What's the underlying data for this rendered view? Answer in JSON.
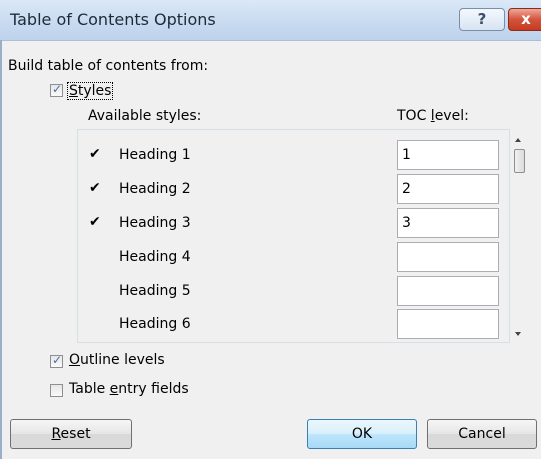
{
  "dialog": {
    "title": "Table of Contents Options",
    "help_glyph": "?",
    "close_glyph": "x"
  },
  "build_label": "Build table of contents from:",
  "styles_option": {
    "label_prefix": "",
    "label_accel": "S",
    "label_suffix": "tyles",
    "checked": true,
    "check_glyph": "✓"
  },
  "columns": {
    "available_styles": "Available styles:",
    "toc_level_prefix": "TOC ",
    "toc_level_accel": "l",
    "toc_level_suffix": "evel:"
  },
  "styles": [
    {
      "name": "Heading 1",
      "checked": true,
      "check_glyph": "✔",
      "level": "1"
    },
    {
      "name": "Heading 2",
      "checked": true,
      "check_glyph": "✔",
      "level": "2"
    },
    {
      "name": "Heading 3",
      "checked": true,
      "check_glyph": "✔",
      "level": "3"
    },
    {
      "name": "Heading 4",
      "checked": false,
      "check_glyph": "",
      "level": ""
    },
    {
      "name": "Heading 5",
      "checked": false,
      "check_glyph": "",
      "level": ""
    },
    {
      "name": "Heading 6",
      "checked": false,
      "check_glyph": "",
      "level": ""
    }
  ],
  "outline_levels": {
    "label_accel": "O",
    "label_suffix": "utline levels",
    "checked": true,
    "check_glyph": "✓"
  },
  "table_entry_fields": {
    "label_prefix": "Table ",
    "label_accel": "e",
    "label_suffix": "ntry fields",
    "checked": false,
    "check_glyph": ""
  },
  "buttons": {
    "reset_accel": "R",
    "reset_suffix": "eset",
    "ok": "OK",
    "cancel": "Cancel"
  },
  "colors": {
    "titlebar": "#c7daf0",
    "close_button": "#c43b22",
    "ok_button": "#bee6fd",
    "dialog_bg": "#f0f0f0"
  },
  "icons": {
    "help": "question-mark-icon",
    "close": "close-icon",
    "scroll_up": "scroll-up-arrow-icon",
    "scroll_down": "scroll-down-arrow-icon",
    "check": "checkmark-icon"
  }
}
